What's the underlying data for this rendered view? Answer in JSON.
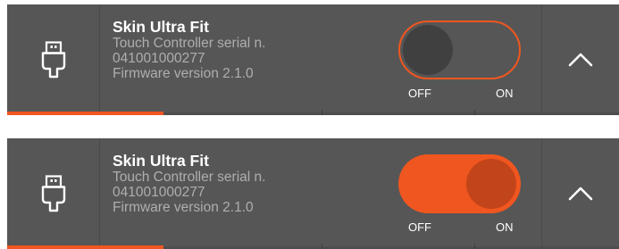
{
  "accent_color": "#f0561f",
  "panel_color": "#565656",
  "devices": [
    {
      "icon": "usb-icon",
      "title": "Skin Ultra Fit",
      "serial_label": "Touch Controller serial n.",
      "serial_number": "041001000277",
      "firmware": "Firmware version 2.1.0",
      "toggle_state": "off",
      "off_label": "OFF",
      "on_label": "ON",
      "expand_icon": "chevron-up-icon"
    },
    {
      "icon": "usb-icon",
      "title": "Skin Ultra Fit",
      "serial_label": "Touch Controller serial n.",
      "serial_number": "041001000277",
      "firmware": "Firmware version 2.1.0",
      "toggle_state": "on",
      "off_label": "OFF",
      "on_label": "ON",
      "expand_icon": "chevron-up-icon"
    }
  ]
}
